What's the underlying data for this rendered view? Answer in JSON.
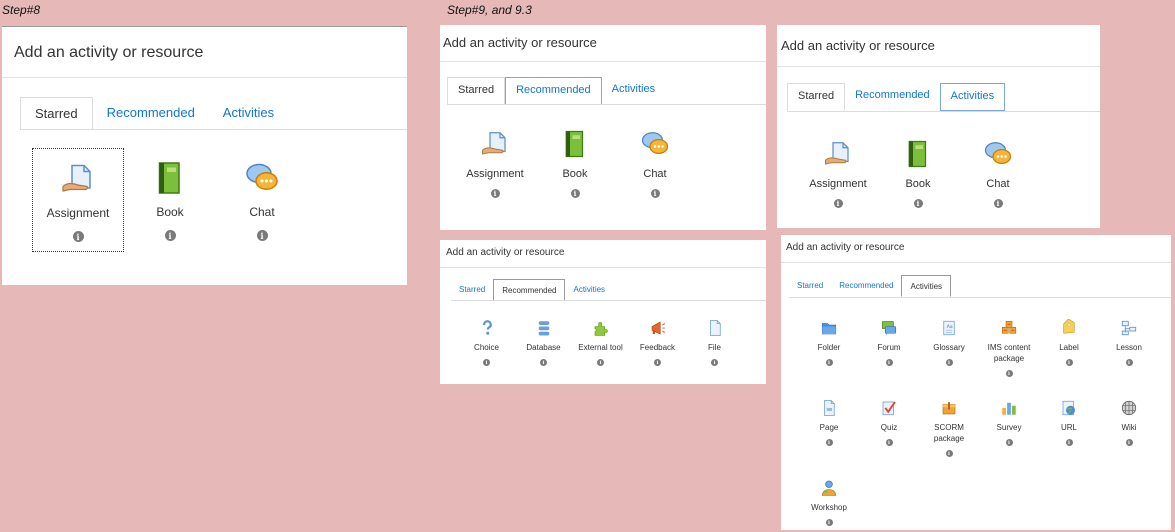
{
  "step_labels": {
    "left": "Step#8",
    "right": "Step#9, and 9.3"
  },
  "panel_title": "Add an activity or resource",
  "tabs": {
    "starred": "Starred",
    "recommended": "Recommended",
    "activities": "Activities"
  },
  "info_glyph": "i",
  "starred_items": [
    {
      "label": "Assignment",
      "icon": "assignment-icon"
    },
    {
      "label": "Book",
      "icon": "book-icon"
    },
    {
      "label": "Chat",
      "icon": "chat-icon"
    }
  ],
  "recommended_items": [
    {
      "label": "Choice",
      "icon": "choice-icon"
    },
    {
      "label": "Database",
      "icon": "database-icon"
    },
    {
      "label": "External tool",
      "icon": "external-tool-icon"
    },
    {
      "label": "Feedback",
      "icon": "feedback-icon"
    },
    {
      "label": "File",
      "icon": "file-icon"
    }
  ],
  "activities_items": [
    {
      "label": "Folder",
      "icon": "folder-icon"
    },
    {
      "label": "Forum",
      "icon": "forum-icon"
    },
    {
      "label": "Glossary",
      "icon": "glossary-icon"
    },
    {
      "label": "IMS content package",
      "icon": "ims-package-icon"
    },
    {
      "label": "Label",
      "icon": "label-icon"
    },
    {
      "label": "Lesson",
      "icon": "lesson-icon"
    },
    {
      "label": "Page",
      "icon": "page-icon"
    },
    {
      "label": "Quiz",
      "icon": "quiz-icon"
    },
    {
      "label": "SCORM package",
      "icon": "scorm-icon"
    },
    {
      "label": "Survey",
      "icon": "survey-icon"
    },
    {
      "label": "URL",
      "icon": "url-icon"
    },
    {
      "label": "Wiki",
      "icon": "wiki-icon"
    },
    {
      "label": "Workshop",
      "icon": "workshop-icon"
    }
  ],
  "colors": {
    "link": "#1177d1",
    "background": "#e6b8b8",
    "info": "#7a7a7a"
  }
}
